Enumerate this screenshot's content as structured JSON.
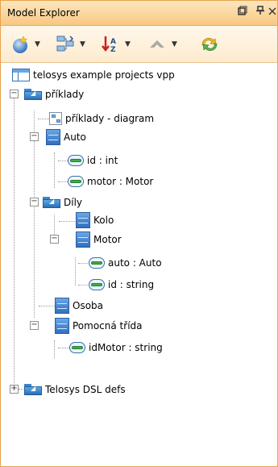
{
  "panel": {
    "title": "Model Explorer",
    "buttons": {
      "restore": "❐",
      "pin": "⚓",
      "close": "×"
    }
  },
  "toolbar": {
    "icons": [
      "new-element-icon",
      "layout-icon",
      "sort-icon",
      "navigate-up-icon",
      "refresh-icon"
    ]
  },
  "tree": {
    "root": "telosys example projects vpp",
    "pkg1": "příklady",
    "diagram": "příklady - diagram",
    "auto": "Auto",
    "auto_id": "id : int",
    "auto_motor": "motor : Motor",
    "pkg_dily": "Díly",
    "kolo": "Kolo",
    "motor": "Motor",
    "motor_auto": "auto : Auto",
    "motor_id": "id : string",
    "osoba": "Osoba",
    "pomocna": "Pomocná třída",
    "idmotor": "idMotor : string",
    "telosys_dsl": "Telosys DSL defs"
  },
  "colors": {
    "accent": "#f8c982",
    "border": "#e8a24a"
  }
}
